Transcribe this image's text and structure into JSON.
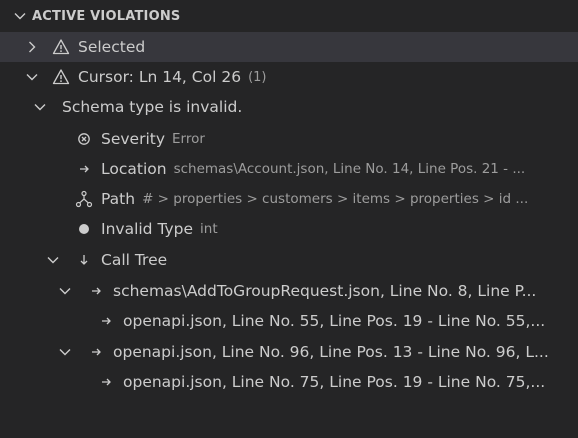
{
  "panel": {
    "title": "ACTIVE VIOLATIONS"
  },
  "tree": {
    "selected": {
      "label": "Selected"
    },
    "cursor": {
      "label": "Cursor: Ln 14, Col 26",
      "count": "(1)"
    },
    "violation": {
      "label": "Schema type is invalid."
    },
    "severity": {
      "label": "Severity",
      "value": "Error"
    },
    "location": {
      "label": "Location",
      "value": "schemas\\Account.json, Line No. 14, Line Pos. 21 - ..."
    },
    "path": {
      "label": "Path",
      "value": "# > properties > customers > items > properties > id ..."
    },
    "invalid_type": {
      "label": "Invalid Type",
      "value": "int"
    },
    "call_tree": {
      "label": "Call Tree",
      "items": [
        {
          "label": "schemas\\AddToGroupRequest.json, Line No. 8, Line P...",
          "child": "openapi.json, Line No. 55, Line Pos. 19 - Line No. 55,..."
        },
        {
          "label": "openapi.json, Line No. 96, Line Pos. 13 - Line No. 96, L...",
          "child": "openapi.json, Line No. 75, Line Pos. 19 - Line No. 75,..."
        }
      ]
    }
  },
  "colors": {
    "background": "#252526",
    "selected_row": "#37373d",
    "text": "#cccccc",
    "description": "#9d9d9d"
  },
  "icons": {
    "header": "chevron-down-icon",
    "selected": "warning-icon",
    "cursor": "warning-icon",
    "severity": "error-circle-icon",
    "location": "arrow-right-icon",
    "path": "type-hierarchy-icon",
    "invalid_type": "circle-filled-icon",
    "call_tree": "arrow-down-icon",
    "call_item": "arrow-right-icon"
  }
}
